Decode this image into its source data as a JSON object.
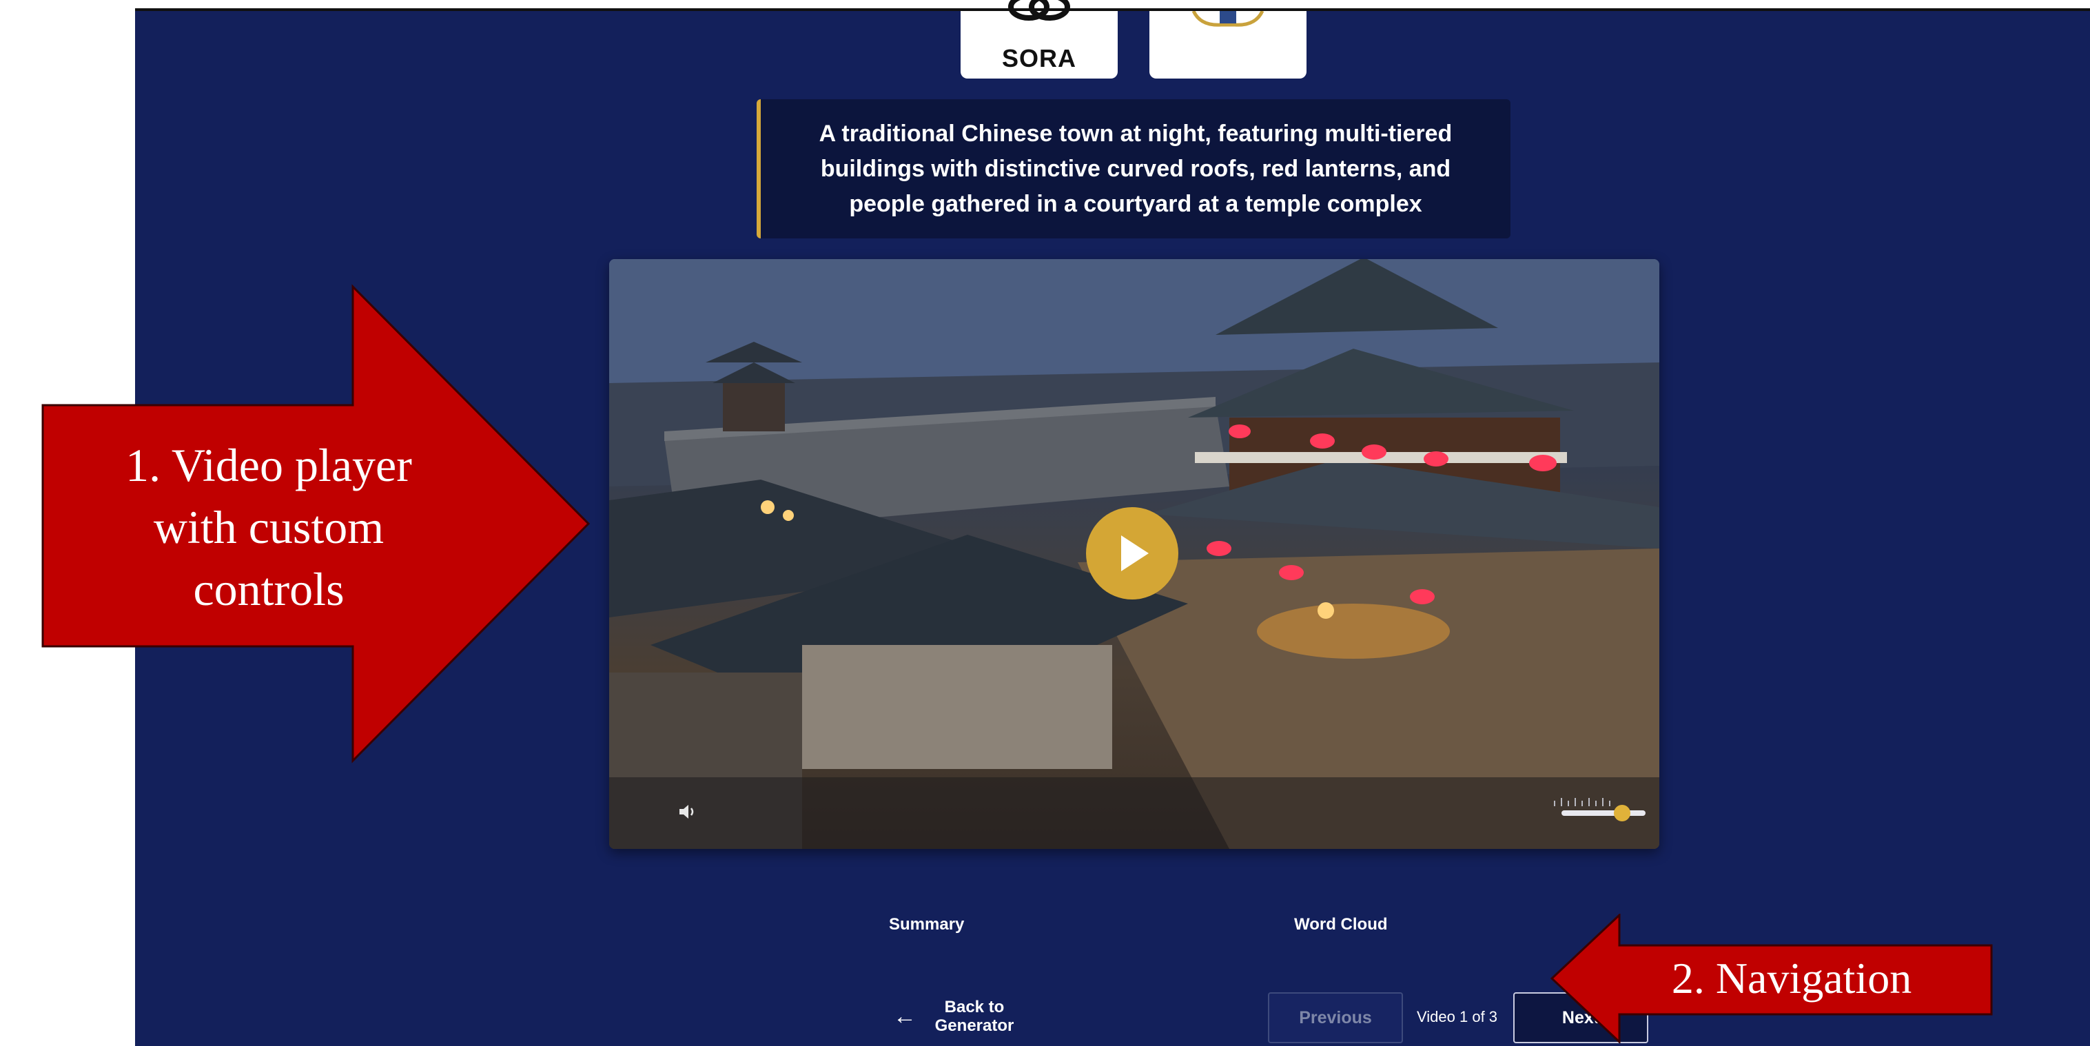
{
  "logos": {
    "sora": "SORA"
  },
  "prompt_caption": "A traditional Chinese town at night, featuring multi-tiered buildings with distinctive curved roofs, red lanterns, and people gathered in a courtyard at a temple complex",
  "player": {
    "volume_level": 0.72
  },
  "tabs": {
    "summary": "Summary",
    "word_cloud": "Word Cloud"
  },
  "nav": {
    "back_label": "Back to Generator",
    "previous_label": "Previous",
    "counter": "Video 1 of 3",
    "next_label": "Next"
  },
  "annotations": {
    "one": "1. Video player with custom controls",
    "two": "2. Navigation"
  },
  "colors": {
    "background": "#13205b",
    "accent_gold": "#d4a635",
    "annotation_red": "#c00000"
  }
}
